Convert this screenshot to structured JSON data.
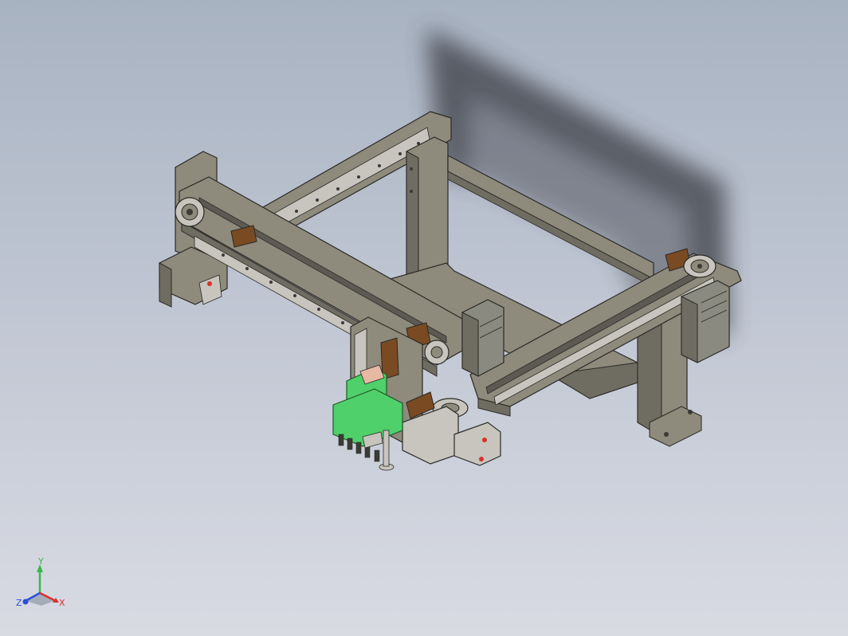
{
  "viewport": {
    "background_top": "#a8b3c2",
    "background_bottom": "#d9dbe3"
  },
  "model": {
    "frame_color": "#8e8a7c",
    "frame_edge": "#2a2a26",
    "rail_color": "#c7c5bd",
    "belt_color": "#5d5a53",
    "slider_color": "#7a4a22",
    "gripper_color": "#4fd06a",
    "motor_color": "#8b8a80"
  },
  "triad": {
    "x_label": "X",
    "y_label": "Y",
    "z_label": "Z",
    "x_color": "#d9302a",
    "y_color": "#38b84c",
    "z_color": "#2a4fd9"
  }
}
